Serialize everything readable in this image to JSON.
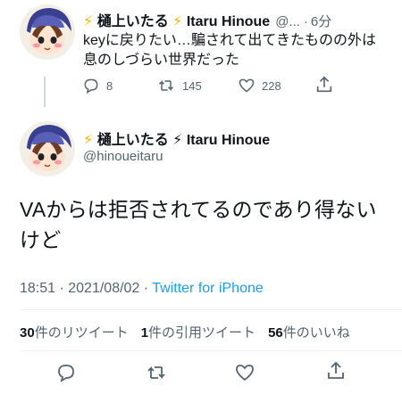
{
  "reply_tweet": {
    "author_prefix": "⚡",
    "author_name": "樋上いたる",
    "author_suffix": "⚡ Itaru Hinoue",
    "handle": "@...",
    "dot": "·",
    "time": "6分",
    "text_line1": "keyに戻りたい…騙されて出てきたものの外は",
    "text_line2": "息のしづらい世界だった",
    "replies": "8",
    "retweets": "145",
    "likes": "228"
  },
  "main_tweet": {
    "author_prefix": "⚡",
    "author_name": "樋上いたる",
    "author_suffix": "⚡ Itaru Hinoue",
    "handle": "@hinoueitaru",
    "text_line1": "VAからは拒否されてるのであり得ない",
    "text_line2": "けど",
    "timestamp": "18:51 · 2021/08/02 · ",
    "source": "Twitter for iPhone",
    "retweet_count": "30",
    "retweet_label": "件のリツイート",
    "quote_count": "1",
    "quote_label": "件の引用ツイート",
    "like_count": "56",
    "like_label": "件のいいね"
  },
  "colors": {
    "accent": "#1d9bf0",
    "secondary_text": "#536471",
    "bolt": "#f5b400"
  },
  "icons": [
    "reply-icon",
    "retweet-icon",
    "like-icon",
    "share-icon"
  ]
}
